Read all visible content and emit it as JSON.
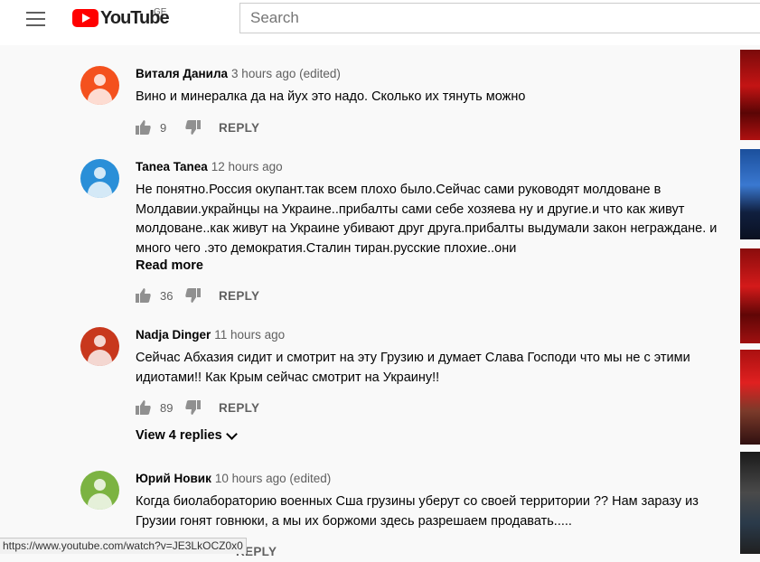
{
  "header": {
    "logo_text": "YouTube",
    "region": "GE",
    "search_placeholder": "Search"
  },
  "comments": [
    {
      "author": "Виталя Данила",
      "time": "3 hours ago (edited)",
      "text": "Вино и минералка да на йух это надо. Сколько их тянуть можно",
      "likes": "9",
      "reply_label": "REPLY",
      "avatar_color": "#f4511e"
    },
    {
      "author": "Tanea Tanea",
      "time": "12 hours ago",
      "text": "Не понятно.Россия окупант.так всем плохо было.Сейчас сами руководят молдоване в Молдавии.украйнцы на Украине..прибалты сами себе хозяева ну и другие.и что как живут молдоване..как живут на Украине убивают друг друга.прибалты  выдумали закон неграждане. и много чего .это демократия.Сталин тиран.русские плохие..они",
      "read_more": "Read more",
      "likes": "36",
      "reply_label": "REPLY",
      "avatar_color": "#2a8fd8"
    },
    {
      "author": "Nadja Dinger",
      "time": "11 hours ago",
      "text": "Сейчас Абхазия сидит и смотрит на эту Грузию и думает Слава Господи что мы не с этими идиотами!! Как Крым сейчас смотрит на Украину!!",
      "likes": "89",
      "reply_label": "REPLY",
      "view_replies": "View 4 replies",
      "avatar_color": "#c8381d"
    },
    {
      "author": "Юрий Новик",
      "time": "10 hours ago (edited)",
      "text": "Когда биолабораторию военных  Сша грузины уберут со своей территории  ?? Нам заразу из Грузии гонят говнюки, а мы их боржоми здесь разрешаем продавать.....",
      "reply_label": "REPLY",
      "avatar_color": "#7cb342"
    }
  ],
  "status_url": "https://www.youtube.com/watch?v=JE3LkOCZ0x0"
}
